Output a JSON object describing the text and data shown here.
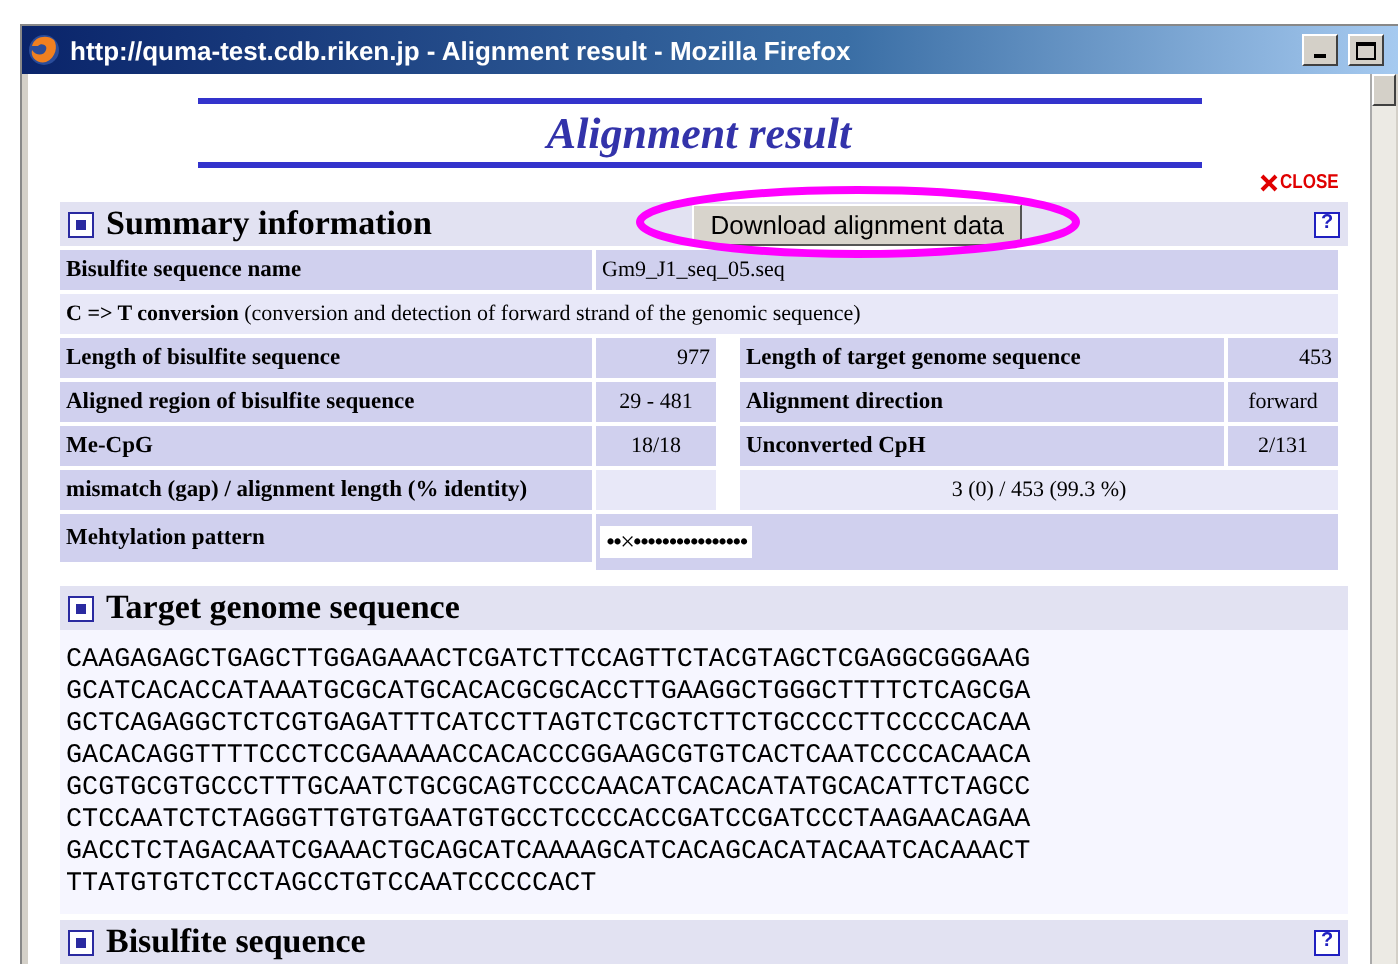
{
  "window": {
    "title": "http://quma-test.cdb.riken.jp - Alignment result - Mozilla Firefox"
  },
  "page": {
    "title": "Alignment result",
    "close_label": "CLOSE"
  },
  "summary": {
    "heading": "Summary information",
    "download_button": "Download alignment data",
    "help": "?",
    "rows": [
      {
        "kind": "wide",
        "label": "Bisulfite sequence name",
        "value": "Gm9_J1_seq_05.seq"
      },
      {
        "kind": "note",
        "text": "**C => T conversion** (conversion and detection of forward strand of the genomic sequence)"
      },
      {
        "kind": "pair",
        "cells": [
          "Length of bisulfite sequence",
          "977",
          "Length of target genome sequence",
          "453"
        ]
      },
      {
        "kind": "pair",
        "cells": [
          "Aligned region of bisulfite sequence",
          "29 - 481",
          "Alignment direction",
          "forward"
        ]
      },
      {
        "kind": "pair",
        "cells": [
          "Me-CpG",
          "18/18",
          "Unconverted CpH",
          "2/131"
        ]
      },
      {
        "kind": "span",
        "label": "mismatch (gap) / alignment length (% identity)",
        "value": "3 (0) / 453 (99.3 %)"
      },
      {
        "kind": "pattern",
        "label": "Mehtylation pattern",
        "value": "••×••••••••••••••••"
      }
    ]
  },
  "target": {
    "heading": "Target genome sequence",
    "lines": [
      "CAAGAGAGCTGAGCTTGGAGAAACTCGATCTTCCAGTTCTACGTAGCTCGAGGCGGGAAG",
      "GCATCACACCATAAATGCGCATGCACACGCGCACCTTGAAGGCTGGGCTTTTCTCAGCGA",
      "GCTCAGAGGCTCTCGTGAGATTTCATCCTTAGTCTCGCTCTTCTGCCCCTTCCCCCACAA",
      "GACACAGGTTTTCCCTCCGAAAAACCACACCCGGAAGCGTGTCACTCAATCCCCACAACA",
      "GCGTGCGTGCCCTTTGCAATCTGCGCAGTCCCCAACATCACACATATGCACATTCTAGCC",
      "CTCCAATCTCTAGGGTTGTGTGAATGTGCCTCCCCACCGATCCGATCCCTAAGAACAGAA",
      "GACCTCTAGACAATCGAAACTGCAGCATCAAAAGCATCACAGCACATACAATCACAAACT",
      "TTATGTGTCTCCTAGCCTGTCCAATCCCCCACT"
    ]
  },
  "bisulfite": {
    "heading": "Bisulfite sequence",
    "help": "?"
  }
}
